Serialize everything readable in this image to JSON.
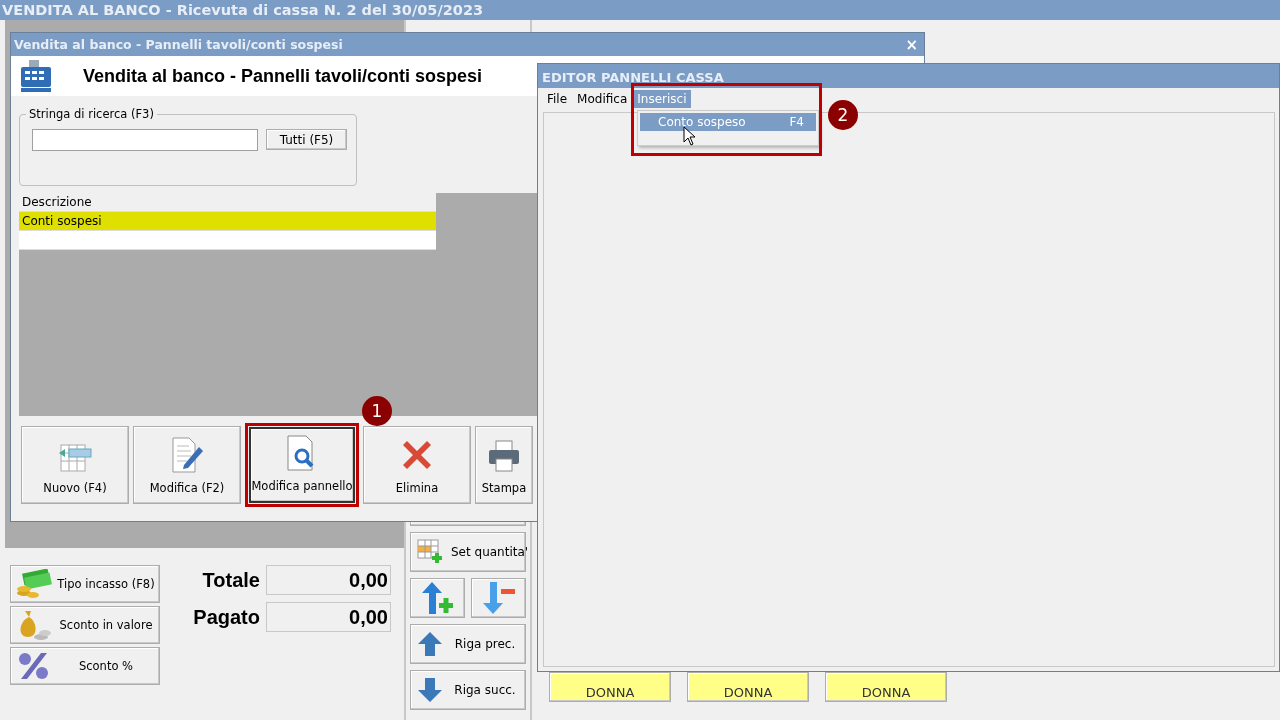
{
  "main_window": {
    "title": "VENDITA AL BANCO - Ricevuta di cassa N. 2 del 30/05/2023",
    "payment_buttons": [
      {
        "label": "Tipo incasso (F8)"
      },
      {
        "label": "Sconto in valore"
      },
      {
        "label": "Sconto %"
      }
    ],
    "totals": [
      {
        "label": "Totale",
        "value": "0,00"
      },
      {
        "label": "Pagato",
        "value": "0,00"
      }
    ],
    "row_buttons": [
      {
        "kind": "wide",
        "label": "Set quantita'"
      },
      {
        "kind": "half"
      },
      {
        "kind": "half"
      },
      {
        "kind": "wide",
        "label": "Riga prec."
      },
      {
        "kind": "wide",
        "label": "Riga succ."
      }
    ],
    "panel_buttons": [
      {
        "label": "DONNA"
      },
      {
        "label": "DONNA"
      },
      {
        "label": "DONNA"
      }
    ]
  },
  "dialog": {
    "title": "Vendita al banco - Pannelli tavoli/conti sospesi",
    "close": "×",
    "heading": "Vendita al banco - Pannelli tavoli/conti sospesi",
    "search": {
      "label": "Stringa di ricerca (F3)",
      "button": "Tutti (F5)"
    },
    "table": {
      "columns": [
        "Descrizione"
      ],
      "rows": [
        {
          "cells": [
            "Conti sospesi"
          ],
          "selected": true
        }
      ]
    },
    "toolbar": [
      {
        "label": "Nuovo (F4)",
        "highlighted": false
      },
      {
        "label": "Modifica (F2)",
        "highlighted": false
      },
      {
        "label": "Modifica pannello",
        "highlighted": true
      },
      {
        "label": "Elimina",
        "highlighted": false
      },
      {
        "label": "Stampa",
        "highlighted": false
      }
    ]
  },
  "editor": {
    "title": "EDITOR PANNELLI CASSA",
    "menu": [
      {
        "label": "File",
        "selected": false
      },
      {
        "label": "Modifica",
        "selected": false
      },
      {
        "label": "Inserisci",
        "selected": true
      }
    ],
    "dropdown": [
      {
        "label": "Conto sospeso",
        "shortcut": "F4",
        "selected": true
      }
    ]
  },
  "callouts": [
    {
      "number": "1"
    },
    {
      "number": "2"
    }
  ]
}
